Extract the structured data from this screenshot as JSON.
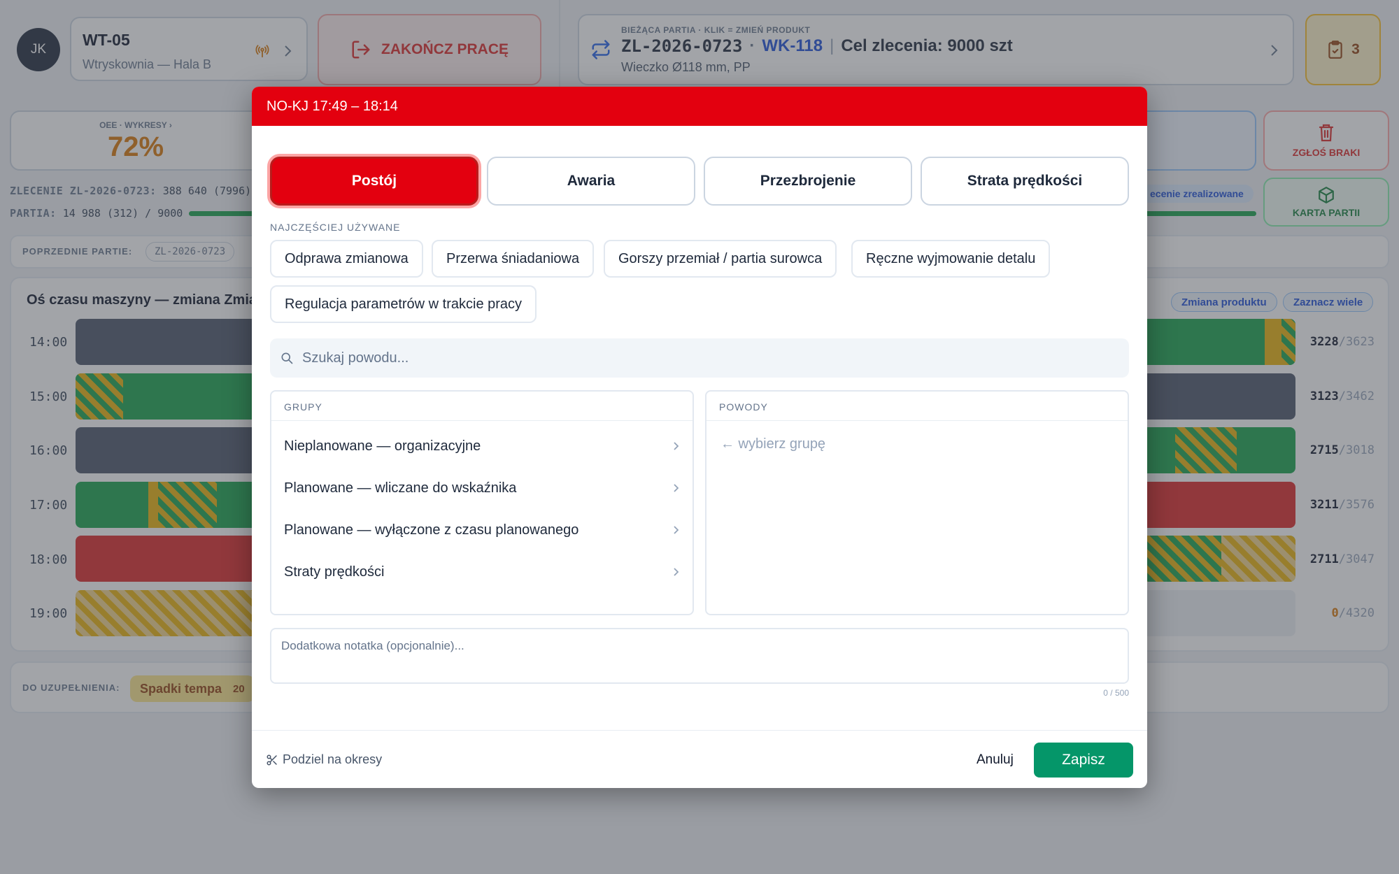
{
  "header": {
    "avatar": "JK",
    "station": {
      "code": "WT-05",
      "name": "Wtryskownia — Hala B"
    },
    "end_work": "ZAKOŃCZ PRACĘ",
    "batch": {
      "caption": "BIEŻĄCA PARTIA · KLIK = ZMIEŃ PRODUKT",
      "order": "ZL-2026-0723",
      "sep": "·",
      "tool": "WK-118",
      "bar": "|",
      "target": "Cel zlecenia: 9000 szt",
      "product": "Wieczko Ø118 mm, PP"
    },
    "tasks_count": "3"
  },
  "status": {
    "oee_label": "OEE · WYKRESY ›",
    "oee_value": "72%",
    "order_label": "ZLECENIE ZL-2026-0723:",
    "order_value": "388 640 (7996)",
    "batch_label": "PARTIA:",
    "batch_value": "14 988 (312) / 9000",
    "done_badge": "ecenie zrealizowane",
    "report_defects": "ZGŁOŚ BRAKI",
    "batch_card": "KARTA PARTII",
    "prev_label": "POPRZEDNIE PARTIE:",
    "prev_chip": "ZL-2026-0723"
  },
  "timeline": {
    "title": "Oś czasu maszyny — zmiana Zmia",
    "btn_change": "Zmiana produktu",
    "btn_multi": "Zaznacz wiele",
    "rows": [
      {
        "hour": "14:00",
        "done": "3228",
        "plan": "3623"
      },
      {
        "hour": "15:00",
        "done": "3123",
        "plan": "3462"
      },
      {
        "hour": "16:00",
        "done": "2715",
        "plan": "3018"
      },
      {
        "hour": "17:00",
        "done": "3211",
        "plan": "3576"
      },
      {
        "hour": "18:00",
        "done": "2711",
        "plan": "3047"
      },
      {
        "hour": "19:00",
        "done": "0",
        "plan": "4320"
      }
    ],
    "slash": "/"
  },
  "todo": {
    "label": "DO UZUPEŁNIENIA:",
    "chip": "Spadki tempa",
    "count": "20"
  },
  "modal": {
    "title": "NO-KJ 17:49 – 18:14",
    "tabs": [
      "Postój",
      "Awaria",
      "Przezbrojenie",
      "Strata prędkości"
    ],
    "frequent_label": "NAJCZĘŚCIEJ UŻYWANE",
    "frequent": [
      "Odprawa zmianowa",
      "Przerwa śniadaniowa",
      "Gorszy przemiał / partia surowca",
      "Ręczne wyjmowanie detalu",
      "Regulacja parametrów w trakcie pracy"
    ],
    "search_placeholder": "Szukaj powodu...",
    "groups_label": "GRUPY",
    "groups": [
      "Nieplanowane — organizacyjne",
      "Planowane — wliczane do wskaźnika",
      "Planowane — wyłączone z czasu planowanego",
      "Straty prędkości"
    ],
    "reasons_label": "POWODY",
    "reasons_hint": "← wybierz grupę",
    "note_placeholder": "Dodatkowa notatka (opcjonalnie)...",
    "counter": "0 / 500",
    "split": "Podziel na okresy",
    "cancel": "Anuluj",
    "save": "Zapisz"
  },
  "colors": {
    "accent_red": "#e3000f",
    "save_green": "#059669",
    "oee_amber": "#d97706"
  }
}
